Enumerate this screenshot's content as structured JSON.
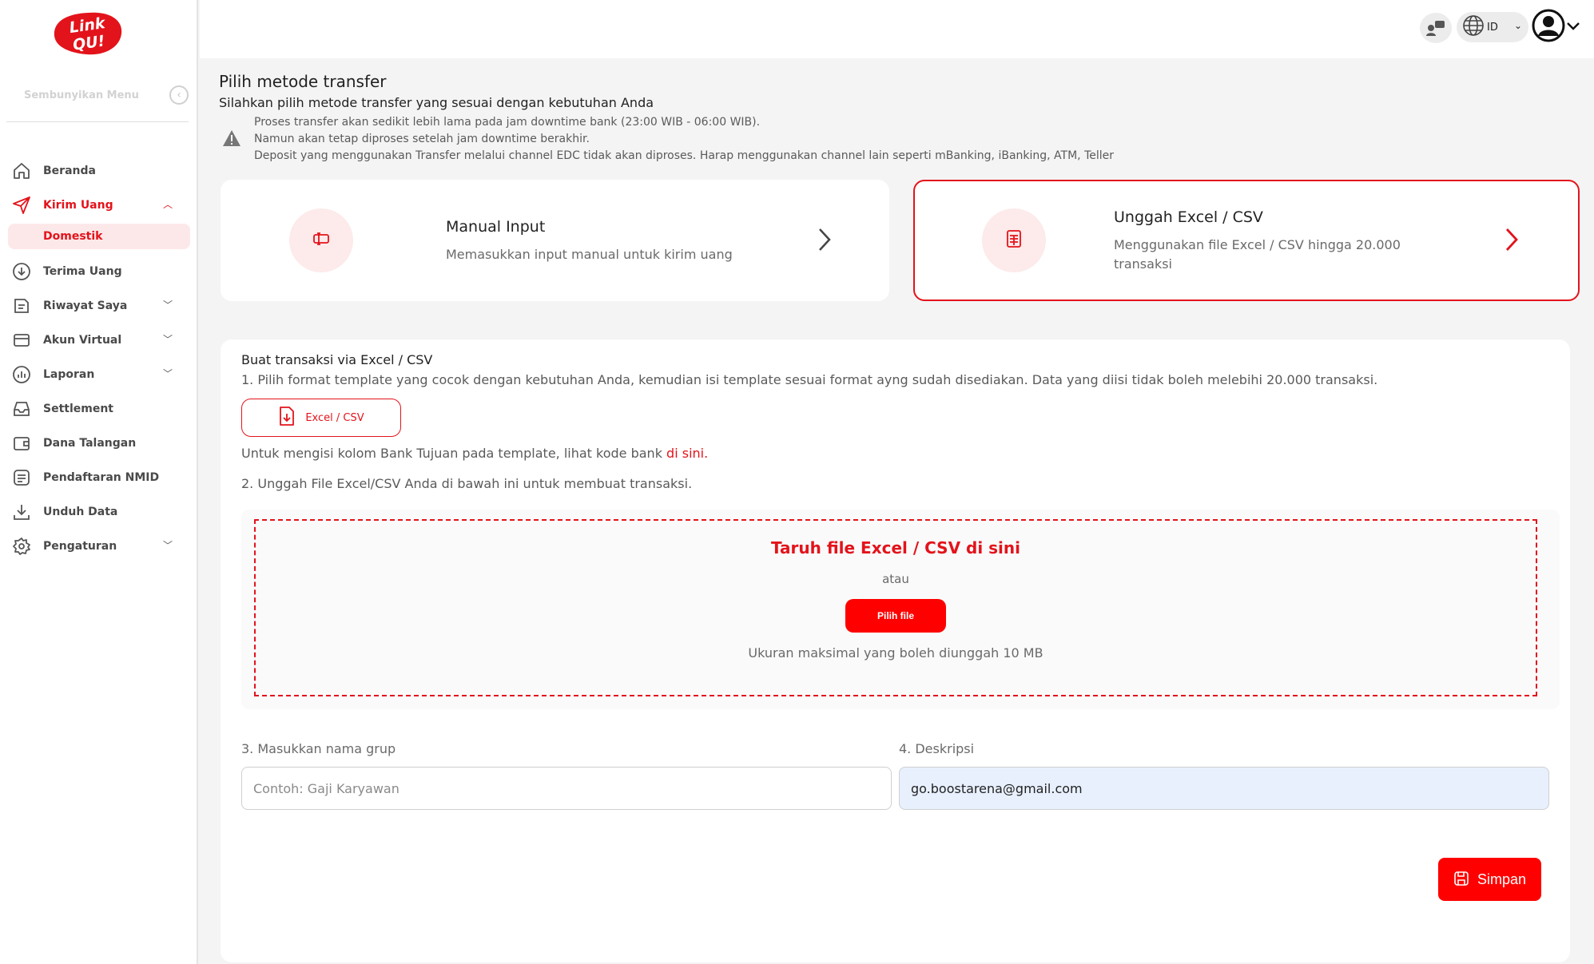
{
  "brand": {
    "logo_line1": "Link",
    "logo_line2": "QU!",
    "accent": "#e3131b",
    "button_red": "#ff0000"
  },
  "sidebar": {
    "hide_menu_label": "Sembunyikan Menu",
    "items": [
      {
        "label": "Beranda",
        "icon": "home-icon"
      },
      {
        "label": "Kirim Uang",
        "icon": "send-icon",
        "active": true,
        "expanded": true
      },
      {
        "label": "Terima Uang",
        "icon": "download-circle-icon"
      },
      {
        "label": "Riwayat Saya",
        "icon": "history-icon"
      },
      {
        "label": "Akun Virtual",
        "icon": "card-icon"
      },
      {
        "label": "Laporan",
        "icon": "chart-icon"
      },
      {
        "label": "Settlement",
        "icon": "inbox-icon"
      },
      {
        "label": "Dana Talangan",
        "icon": "wallet-icon"
      },
      {
        "label": "Pendaftaran NMID",
        "icon": "document-icon"
      },
      {
        "label": "Unduh Data",
        "icon": "download-icon"
      },
      {
        "label": "Pengaturan",
        "icon": "gear-icon"
      }
    ],
    "sub_item": "Domestik"
  },
  "topbar": {
    "language": "ID"
  },
  "page": {
    "title": "Pilih metode transfer",
    "subtitle": "Silahkan pilih metode transfer yang sesuai dengan kebutuhan Anda",
    "notice": [
      "Proses transfer akan sedikit lebih lama pada jam downtime bank (23:00 WIB - 06:00 WIB).",
      "Namun akan tetap diproses setelah jam downtime berakhir.",
      "Deposit yang menggunakan Transfer melalui channel EDC tidak akan diproses. Harap menggunakan channel lain seperti mBanking, iBanking, ATM, Teller"
    ]
  },
  "methods": {
    "manual": {
      "title": "Manual Input",
      "desc": "Memasukkan input manual untuk kirim uang"
    },
    "upload": {
      "title": "Unggah Excel / CSV",
      "desc_line1": "Menggunakan file Excel / CSV hingga 20.000",
      "desc_line2": "transaksi"
    }
  },
  "panel": {
    "heading": "Buat transaksi via Excel / CSV",
    "step1": "1. Pilih format template yang cocok dengan kebutuhan Anda, kemudian isi template sesuai format ayng sudah disediakan. Data yang diisi tidak boleh melebihi 20.000 transaksi.",
    "template_button": "Excel / CSV",
    "bank_text": "Untuk mengisi kolom Bank Tujuan pada template, lihat kode bank ",
    "bank_link": "di sini.",
    "step2": "2. Unggah File Excel/CSV Anda di bawah ini untuk membuat transaksi.",
    "dropzone": {
      "title": "Taruh file Excel / CSV di sini",
      "or": "atau",
      "button": "Pilih file",
      "max": "Ukuran maksimal yang boleh diunggah 10 MB"
    },
    "group_label": "3. Masukkan nama grup",
    "group_placeholder": "Contoh: Gaji Karyawan",
    "group_value": "",
    "desc_label": "4. Deskripsi",
    "desc_value": "go.boostarena@gmail.com",
    "save_button": "Simpan"
  }
}
